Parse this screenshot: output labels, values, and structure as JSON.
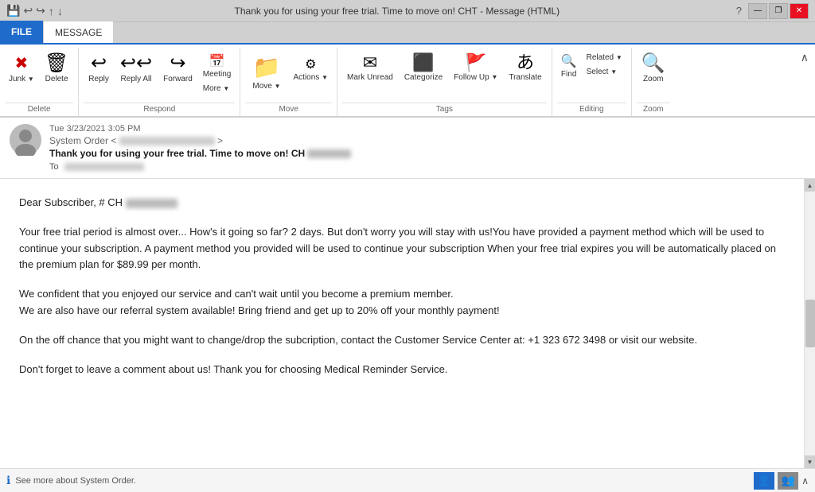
{
  "titlebar": {
    "title": "Thank you for using your free trial. Time to move on! CHT          - Message (HTML)",
    "help": "?",
    "restore": "❐",
    "minimize": "—",
    "close": "✕"
  },
  "tabs": {
    "file": "FILE",
    "message": "MESSAGE"
  },
  "ribbon": {
    "groups": {
      "delete": {
        "label": "Delete",
        "junk_label": "Junk",
        "delete_label": "Delete"
      },
      "respond": {
        "label": "Respond",
        "reply_label": "Reply",
        "reply_all_label": "Reply All",
        "forward_label": "Forward",
        "meeting_label": "Meeting",
        "more_label": "More"
      },
      "move": {
        "label": "Move",
        "move_label": "Move",
        "actions_label": "Actions"
      },
      "tags": {
        "label": "Tags",
        "mark_unread_label": "Mark Unread",
        "categorize_label": "Categorize",
        "follow_up_label": "Follow Up",
        "translate_label": "Translate"
      },
      "editing": {
        "label": "Editing",
        "find_label": "Find",
        "related_label": "Related",
        "select_label": "Select"
      },
      "zoom": {
        "label": "Zoom",
        "zoom_label": "Zoom"
      }
    }
  },
  "email": {
    "date": "Tue 3/23/2021 3:05 PM",
    "from_name": "System Order <",
    "from_email": "                              ",
    "from_close": ">",
    "subject_prefix": "Thank you for using your free trial. Time to move on! CH",
    "to_label": "To",
    "to_value": "",
    "greeting": "Dear Subscriber, # CH",
    "body_p1": "Your free trial period is almost over... How's it going so far? 2 days. But don't worry you will stay with us!You have provided a payment method which will be used to continue your subscription. A payment method you provided will be used to continue your subscription When your free trial expires you will be automatically placed on the premium plan for $89.99 per month.",
    "body_p2": " We confident that you enjoyed our service and can't wait until you become a premium member.\nWe are also have our referral system available! Bring friend and get up to 20% off your monthly payment!",
    "body_p3": "On the off chance that you might want to change/drop the subcription, contact the Customer Service Center at: +1 323 672 3498 or visit our website.",
    "body_p4": "Don't forget to leave a comment about us! Thank you for choosing Medical Reminder Service.",
    "status": "See more about System Order."
  }
}
